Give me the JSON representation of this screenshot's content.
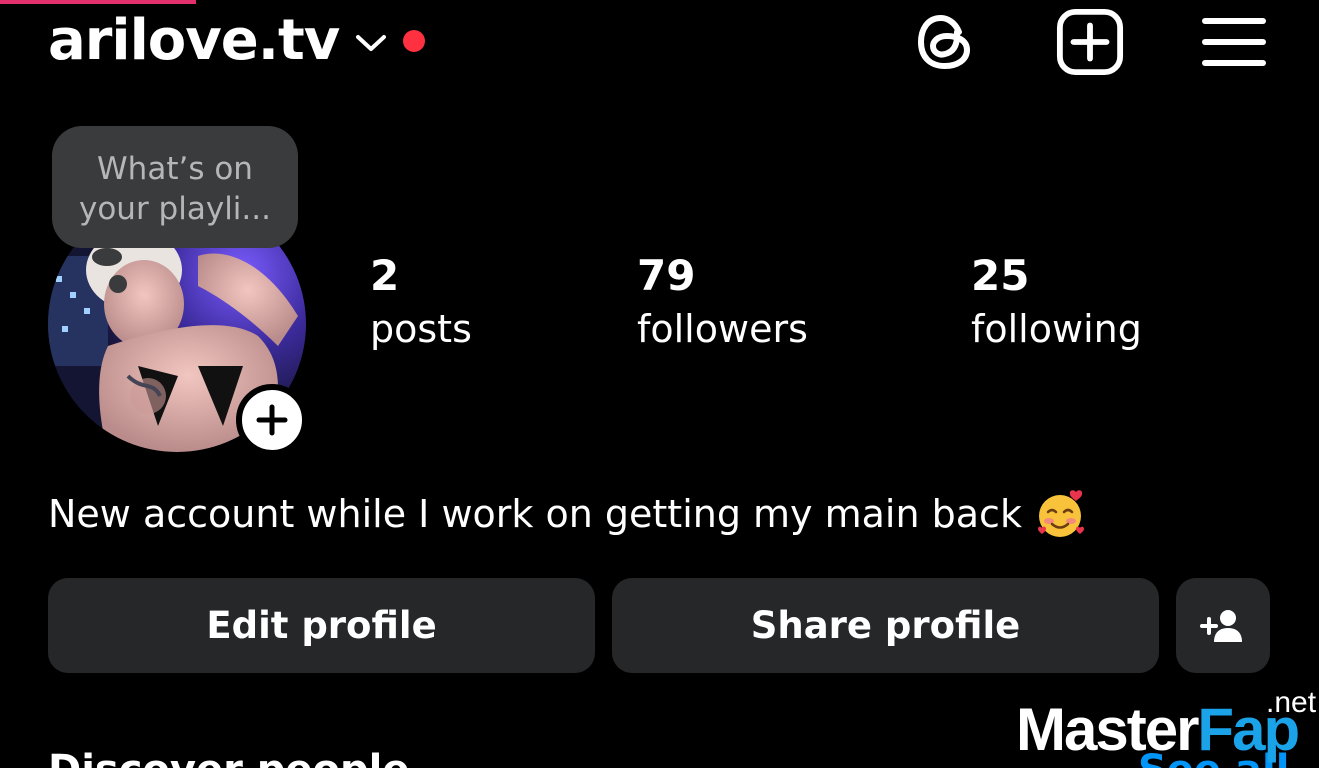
{
  "header": {
    "username": "arilove.tv",
    "switch_account_icon": "chevron-down-icon",
    "notification_dot_color": "#ff3040",
    "icons": [
      "threads-icon",
      "create-post-icon",
      "menu-icon"
    ]
  },
  "note": {
    "line1": "What’s on",
    "line2": "your playli..."
  },
  "avatar": {
    "add_story_icon": "plus-icon"
  },
  "stats": [
    {
      "value": "2",
      "label": "posts"
    },
    {
      "value": "79",
      "label": "followers"
    },
    {
      "value": "25",
      "label": "following"
    }
  ],
  "bio": {
    "text": "New account while I work on getting my main back",
    "emoji": "smiling-face-with-hearts-emoji"
  },
  "actions": {
    "edit_profile": "Edit profile",
    "share_profile": "Share profile",
    "discover_icon": "add-person-icon"
  },
  "discover": {
    "title": "Discover people",
    "see_all": "See all"
  },
  "watermark": {
    "part1": "Master",
    "part2": "Fap",
    "suffix": ".net"
  },
  "colors": {
    "background": "#000000",
    "button_bg": "#262729",
    "note_bg": "#3a3b3d",
    "link": "#0095f6",
    "accent": "#e1306c"
  }
}
